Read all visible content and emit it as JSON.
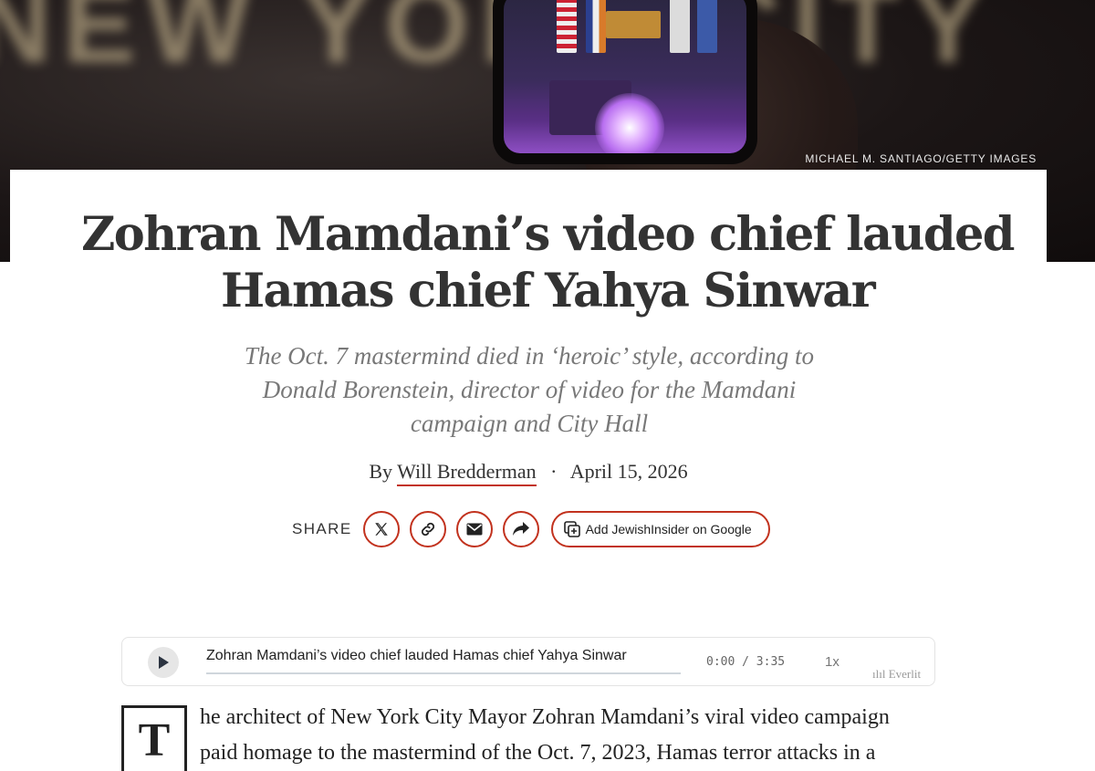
{
  "hero": {
    "credit": "MICHAEL M. SANTIAGO/GETTY IMAGES",
    "background_sign_text": "NEW YORK CITY"
  },
  "article": {
    "headline_line1": "Zohran Mamdani’s video chief lauded",
    "headline_line2": "Hamas chief Yahya Sinwar",
    "subhead_line1": "The Oct. 7 mastermind died in ‘heroic’ style, according to",
    "subhead_line2": "Donald Borenstein, director of video for the Mamdani",
    "subhead_line3": "campaign and City Hall",
    "byline_prefix": "By",
    "author": "Will Bredderman",
    "separator": "·",
    "date": "April 15, 2026"
  },
  "share": {
    "label": "SHARE",
    "buttons": [
      {
        "icon": "x-logo-icon"
      },
      {
        "icon": "link-icon"
      },
      {
        "icon": "email-icon"
      },
      {
        "icon": "share-arrow-icon"
      }
    ],
    "google_label": "Add JewishInsider on Google"
  },
  "player": {
    "title": "Zohran Mamdani’s video chief lauded Hamas chief Yahya Sinwar",
    "time": "0:00 / 3:35",
    "speed": "1x",
    "brand": "Everlit",
    "progress": 0
  },
  "body": {
    "dropcap": "T",
    "line1": "he architect of New York City Mayor Zohran Mamdani’s viral video campaign",
    "line2": "paid homage to the mastermind of the Oct. 7, 2023, Hamas terror attacks in a"
  },
  "colors": {
    "accent": "#c2321e",
    "headline": "#333333",
    "subhead": "#787878"
  }
}
